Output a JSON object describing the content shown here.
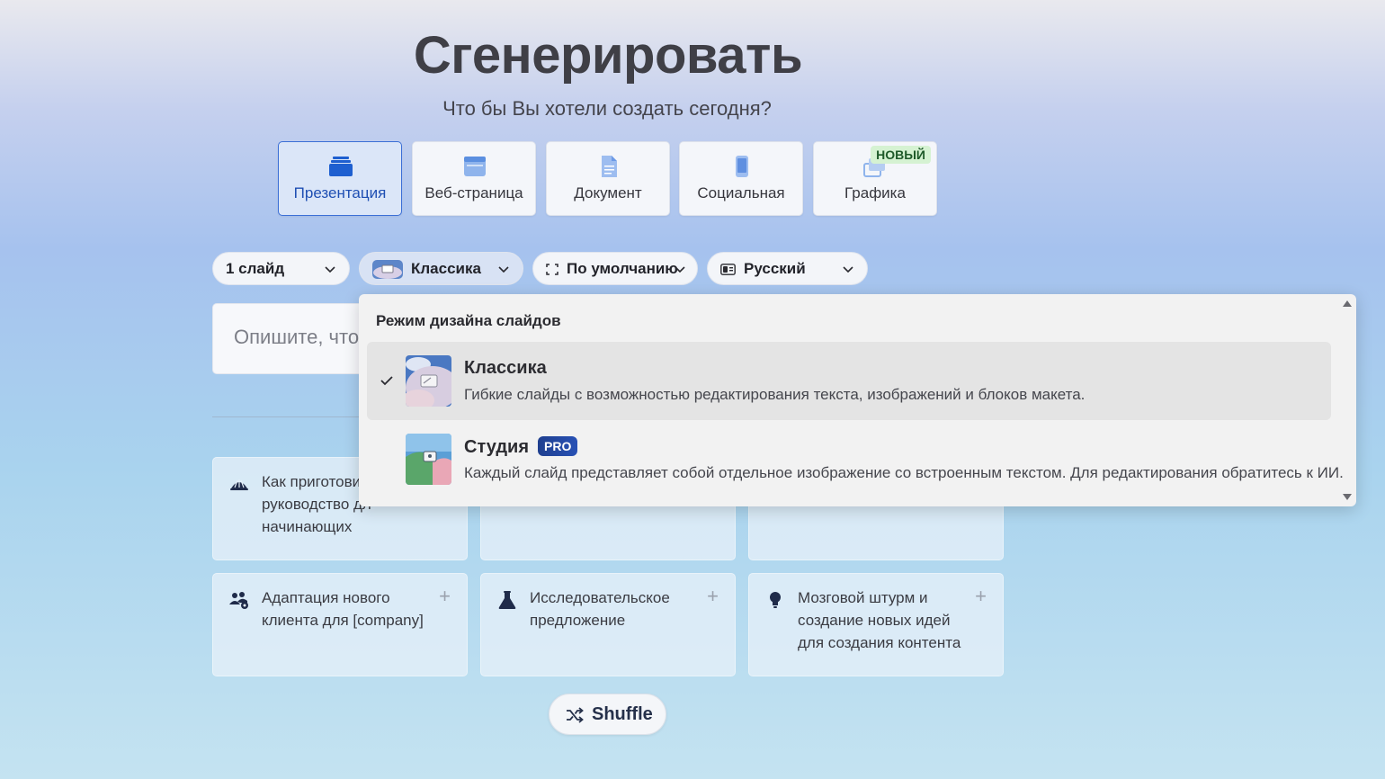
{
  "header": {
    "title": "Сгенерировать",
    "subtitle": "Что бы Вы хотели создать сегодня?"
  },
  "content_types": [
    {
      "label": "Презентация",
      "icon": "stack-icon",
      "active": true
    },
    {
      "label": "Веб-страница",
      "icon": "browser-icon"
    },
    {
      "label": "Документ",
      "icon": "document-icon"
    },
    {
      "label": "Социальная",
      "icon": "phone-icon"
    },
    {
      "label": "Графика",
      "icon": "images-icon",
      "badge": "НОВЫЙ"
    }
  ],
  "options": {
    "slides": "1 слайд",
    "design": "Классика",
    "format": "По умолчанию",
    "language": "Русский"
  },
  "prompt": {
    "placeholder": "Опишите, что"
  },
  "suggestions": [
    {
      "text": "Как приготови",
      "text2": "руководство дл",
      "text3": "начинающих",
      "icon": "baking-icon"
    },
    {
      "text": "Адаптация нового клиента для [company]",
      "icon": "users-gear-icon"
    },
    {
      "text": "Исследовательское предложение",
      "icon": "flask-icon"
    },
    {
      "text": "Мозговой штурм и создание новых идей для создания контента",
      "icon": "lightbulb-icon"
    }
  ],
  "shuffle_label": "Shuffle",
  "dropdown": {
    "title": "Режим дизайна слайдов",
    "items": [
      {
        "name": "Классика",
        "desc": "Гибкие слайды с возможностью редактирования текста, изображений и блоков макета.",
        "selected": true
      },
      {
        "name": "Студия",
        "badge": "PRO",
        "desc": "Каждый слайд представляет собой отдельное изображение со встроенным текстом. Для редактирования обратитесь к ИИ."
      }
    ]
  },
  "colors": {
    "accent": "#3b6fd6",
    "icon_blue": "#1e5fd0",
    "dark_icon": "#1f2b4a"
  }
}
